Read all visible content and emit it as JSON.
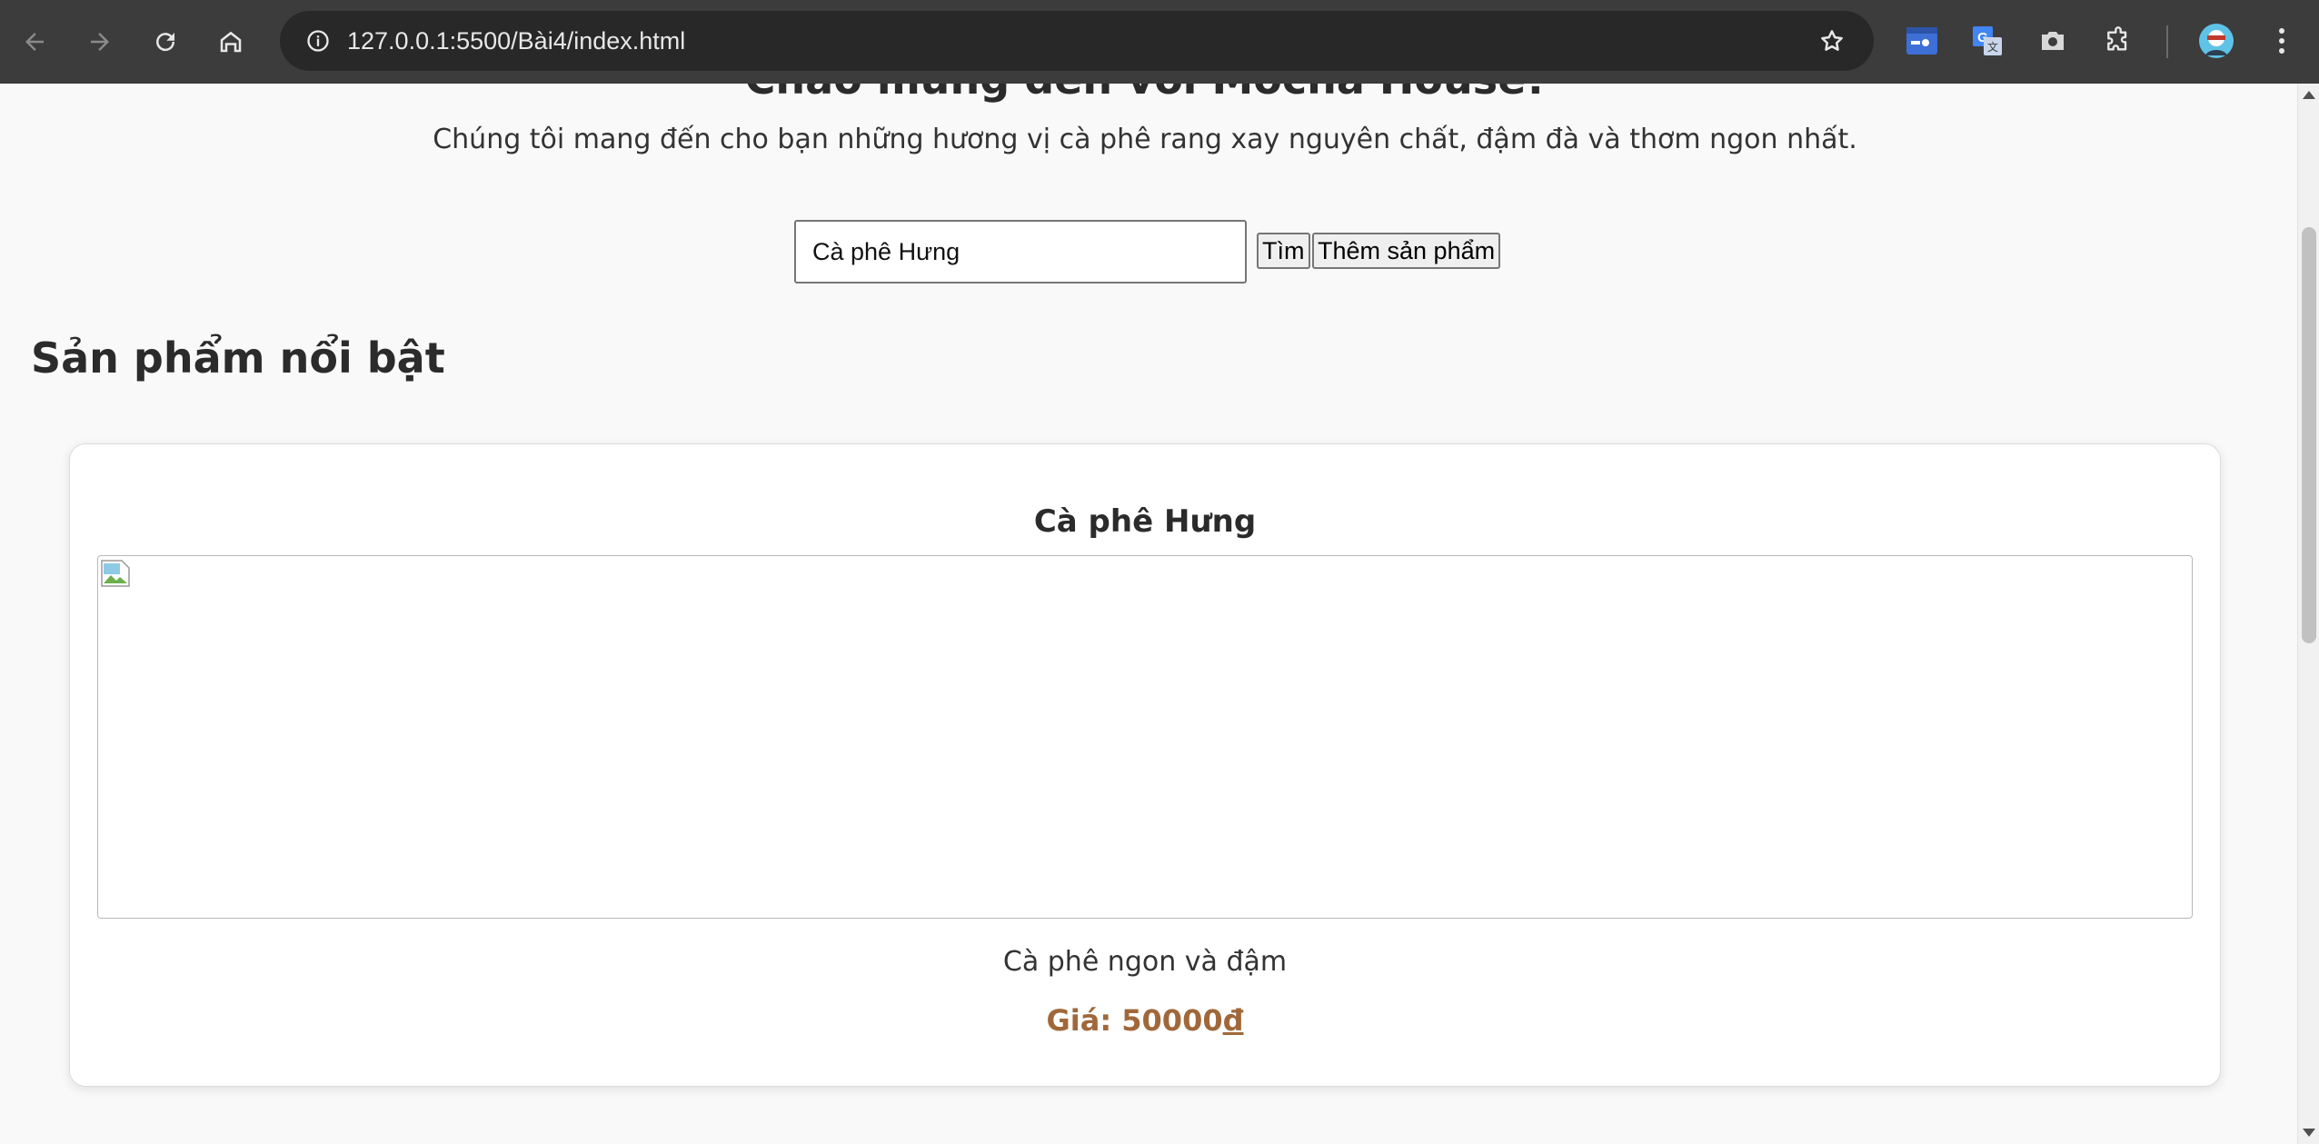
{
  "browser": {
    "url": "127.0.0.1:5500/Bài4/index.html",
    "icons": [
      "back-icon",
      "forward-icon",
      "reload-icon",
      "home-icon",
      "site-info-icon",
      "bookmark-star-icon",
      "extension-icon",
      "translate-icon",
      "camera-icon",
      "puzzle-icon",
      "profile-avatar",
      "kebab-menu-icon"
    ]
  },
  "hero": {
    "title": "Chào mừng đến với Mocha House!",
    "subtitle": "Chúng tôi mang đến cho bạn những hương vị cà phê rang xay nguyên chất, đậm đà và thơm ngon nhất."
  },
  "search": {
    "value": "Cà phê Hưng",
    "search_button": "Tìm",
    "add_button": "Thêm sản phẩm"
  },
  "featured": {
    "title": "Sản phẩm nổi bật",
    "products": [
      {
        "name": "Cà phê Hưng",
        "description": "Cà phê ngon và đậm",
        "price_label": "Giá: ",
        "price_value": "50000",
        "currency": "đ"
      }
    ]
  },
  "colors": {
    "browser_toolbar": "#3c3c3c",
    "omnibox": "#282828",
    "page_background": "#f9f9f9",
    "price_accent": "#a0683a"
  }
}
